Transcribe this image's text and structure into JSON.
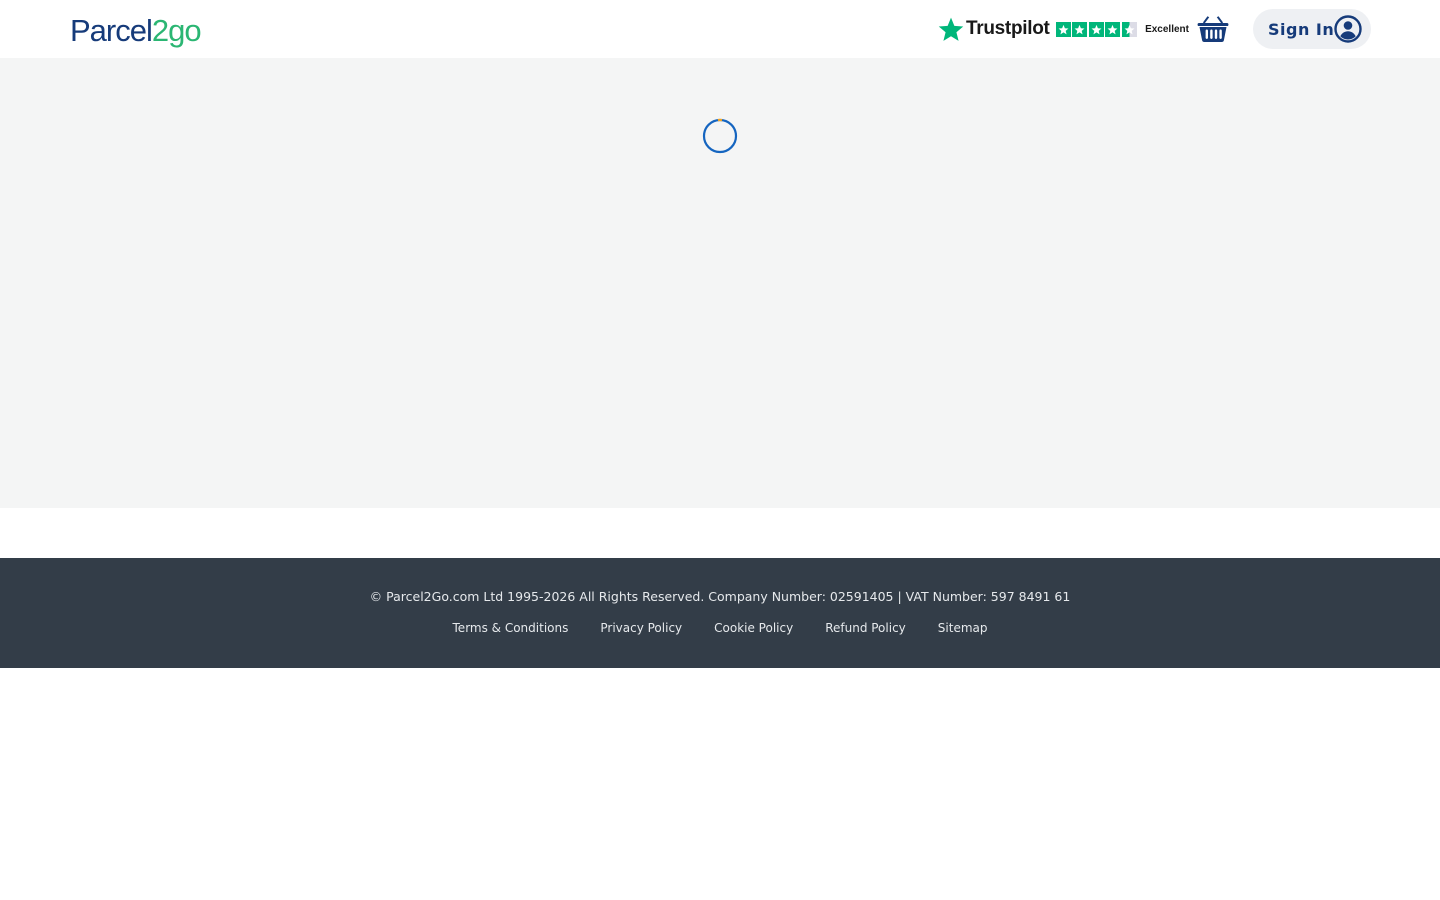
{
  "header": {
    "logo": {
      "part1": "Parcel",
      "part2": "2go"
    },
    "trustpilot": {
      "name": "Trustpilot",
      "rating_text": "Excellent",
      "stars": 4.5,
      "brand_color": "#00b67a"
    },
    "basket_icon": "basket-icon",
    "sign_in_label": "Sign In",
    "user_icon": "user-circle-icon"
  },
  "main": {
    "loading_icon": "spinner-icon"
  },
  "footer": {
    "copyright": "© Parcel2Go.com Ltd 1995-2026 All Rights Reserved. Company Number: 02591405 | VAT Number: 597 8491 61",
    "links": [
      {
        "label": "Terms & Conditions"
      },
      {
        "label": "Privacy Policy"
      },
      {
        "label": "Cookie Policy"
      },
      {
        "label": "Refund Policy"
      },
      {
        "label": "Sitemap"
      }
    ]
  },
  "colors": {
    "brand_navy": "#163b7a",
    "brand_green": "#2bb673",
    "footer_bg": "#333d48",
    "content_bg": "#f4f5f5",
    "spinner_blue": "#1565c0",
    "spinner_accent": "#f5a623"
  }
}
